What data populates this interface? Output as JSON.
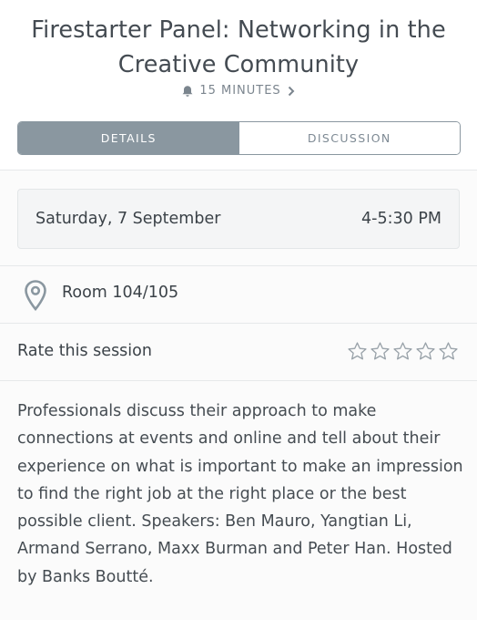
{
  "header": {
    "title": "Firestarter Panel: Networking in the Creative Community",
    "reminder": "15 MINUTES",
    "reminder_icon": "bell-icon"
  },
  "tabs": [
    {
      "label": "DETAILS",
      "active": true
    },
    {
      "label": "DISCUSSION",
      "active": false
    }
  ],
  "schedule": {
    "date": "Saturday, 7 September",
    "time": "4-5:30 PM"
  },
  "location": {
    "room": "Room 104/105",
    "icon": "map-pin-icon"
  },
  "rating": {
    "label": "Rate this session",
    "max_stars": 5,
    "value": 0
  },
  "description": "Professionals discuss their approach to make connections at events and online and tell about their experience on what is important to make an impression to find the right job at the right place or the best possible client. Speakers: Ben Mauro, Yangtian Li, Armand Serrano, Maxx Burman and Peter Han. Hosted by Banks Boutté.",
  "colors": {
    "segment_active": "#8a97a0",
    "text_primary": "#3b4248",
    "text_muted": "#7b858e"
  }
}
